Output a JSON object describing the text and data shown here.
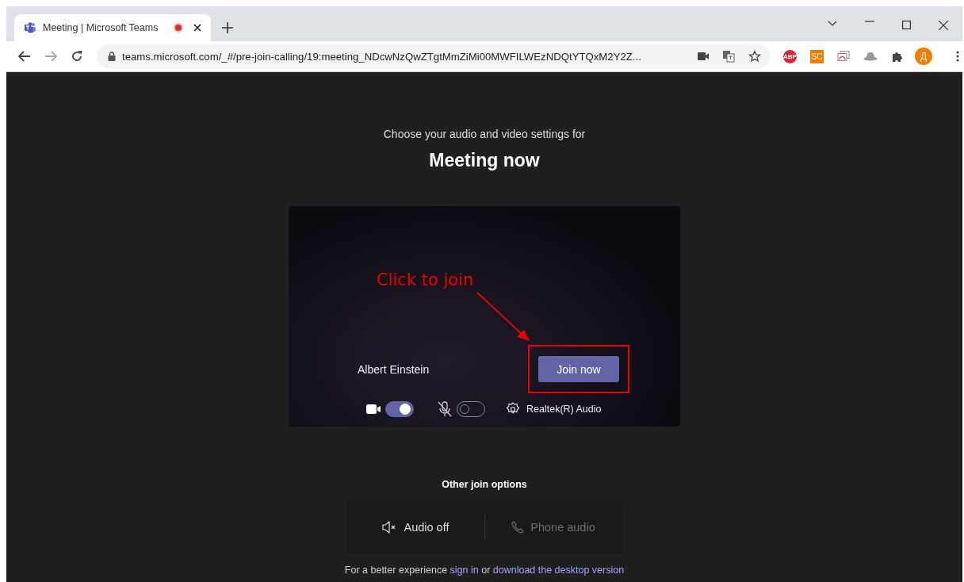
{
  "browser": {
    "tab": {
      "title": "Meeting | Microsoft Teams",
      "recording": true
    },
    "url": "teams.microsoft.com/_#/pre-join-calling/19:meeting_NDcwNzQwZTgtMmZiMi00MWFILWEzNDQtYTQxM2Y2Z...",
    "extensions": [
      {
        "kind": "abp",
        "label": "ABP"
      },
      {
        "kind": "sc",
        "label": "SC"
      }
    ],
    "profile_initial": "Д"
  },
  "page": {
    "intro": "Choose your audio and video settings for",
    "title": "Meeting now",
    "preview": {
      "user_name": "Albert Einstein",
      "join_button": "Join now",
      "camera_on": true,
      "mic_on": false,
      "audio_device": "Realtek(R) Audio"
    },
    "annotation": {
      "label": "Click to join"
    },
    "other_options": {
      "title": "Other join options",
      "options": [
        {
          "kind": "audio_off",
          "label": "Audio off",
          "disabled": false
        },
        {
          "kind": "phone",
          "label": "Phone audio",
          "disabled": true
        }
      ]
    },
    "footer": {
      "before": "For a better experience",
      "sign_in": "sign in",
      "middle": "or",
      "download": "download the desktop version"
    }
  }
}
